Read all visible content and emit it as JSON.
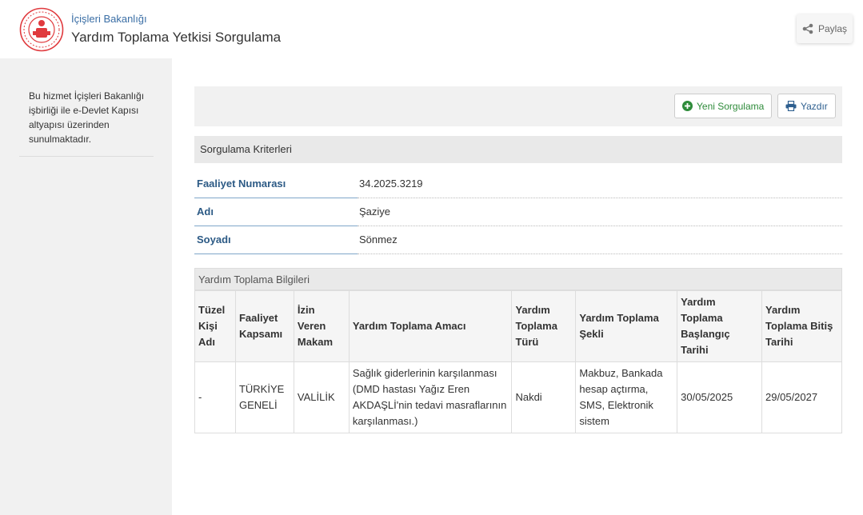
{
  "header": {
    "ministry": "İçişleri Bakanlığı",
    "title": "Yardım Toplama Yetkisi Sorgulama",
    "share_label": "Paylaş"
  },
  "sidebar": {
    "info": "Bu hizmet İçişleri Bakanlığı işbirliği ile e-Devlet Kapısı altyapısı üzerinden sunulmaktadır."
  },
  "toolbar": {
    "new_query_label": "Yeni Sorgulama",
    "print_label": "Yazdır"
  },
  "criteria": {
    "heading": "Sorgulama Kriterleri",
    "rows": [
      {
        "label": "Faaliyet Numarası",
        "value": "34.2025.3219"
      },
      {
        "label": "Adı",
        "value": "Şaziye"
      },
      {
        "label": "Soyadı",
        "value": "Sönmez"
      }
    ]
  },
  "results": {
    "heading": "Yardım Toplama Bilgileri",
    "columns": [
      "Tüzel Kişi Adı",
      "Faaliyet Kapsamı",
      "İzin Veren Makam",
      "Yardım Toplama Amacı",
      "Yardım Toplama Türü",
      "Yardım Toplama Şekli",
      "Yardım Toplama Başlangıç Tarihi",
      "Yardım Toplama Bitiş Tarihi"
    ],
    "rows": [
      [
        "-",
        "TÜRKİYE GENELİ",
        "VALİLİK",
        "Sağlık giderlerinin karşılanması (DMD hastası Yağız Eren AKDAŞLİ'nin tedavi masraflarının karşılanması.)",
        "Nakdi",
        "Makbuz, Bankada hesap açtırma, SMS, Elektronik sistem",
        "30/05/2025",
        "29/05/2027"
      ]
    ]
  },
  "colors": {
    "accent_blue": "#2c5a85",
    "success_green": "#2e8b3a",
    "logo_red": "#e03a3e"
  }
}
